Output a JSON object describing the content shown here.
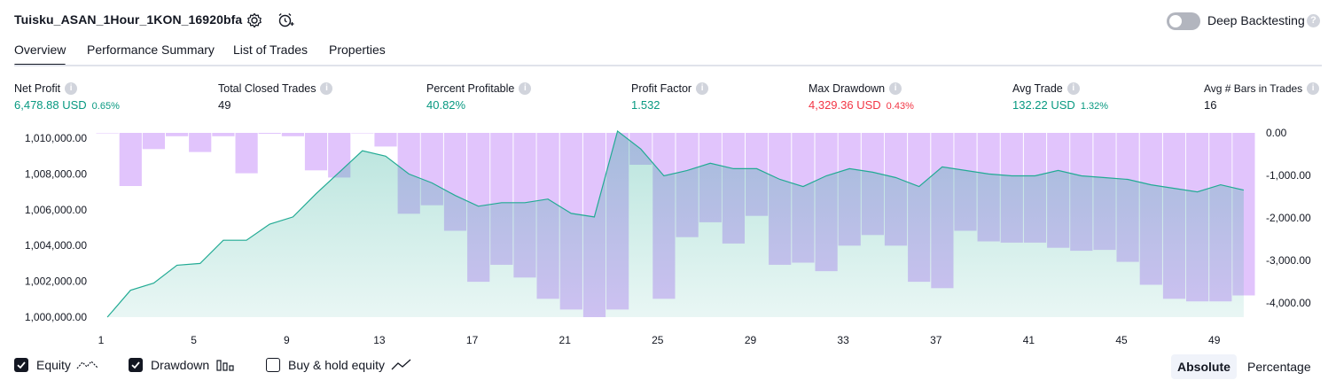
{
  "header": {
    "strategy_title": "Tuisku_ASAN_1Hour_1KON_16920bfa",
    "deep_backtesting_label": "Deep Backtesting",
    "deep_backtesting_enabled": false
  },
  "tabs": [
    {
      "label": "Overview",
      "active": true
    },
    {
      "label": "Performance Summary",
      "active": false
    },
    {
      "label": "List of Trades",
      "active": false
    },
    {
      "label": "Properties",
      "active": false
    }
  ],
  "metrics": [
    {
      "label": "Net Profit",
      "value": "6,478.88 USD",
      "pct": "0.65%",
      "color": "green"
    },
    {
      "label": "Total Closed Trades",
      "value": "49",
      "pct": "",
      "color": "black"
    },
    {
      "label": "Percent Profitable",
      "value": "40.82%",
      "pct": "",
      "color": "green"
    },
    {
      "label": "Profit Factor",
      "value": "1.532",
      "pct": "",
      "color": "green"
    },
    {
      "label": "Max Drawdown",
      "value": "4,329.36 USD",
      "pct": "0.43%",
      "color": "red"
    },
    {
      "label": "Avg Trade",
      "value": "132.22 USD",
      "pct": "1.32%",
      "color": "green"
    },
    {
      "label": "Avg # Bars in Trades",
      "value": "16",
      "pct": "",
      "color": "black"
    }
  ],
  "chart_data": {
    "type": "area",
    "x": [
      1,
      2,
      3,
      4,
      5,
      6,
      7,
      8,
      9,
      10,
      11,
      12,
      13,
      14,
      15,
      16,
      17,
      18,
      19,
      20,
      21,
      22,
      23,
      24,
      25,
      26,
      27,
      28,
      29,
      30,
      31,
      32,
      33,
      34,
      35,
      36,
      37,
      38,
      39,
      40,
      41,
      42,
      43,
      44,
      45,
      46,
      47,
      48,
      49,
      50
    ],
    "x_tick_labels": [
      "1",
      "5",
      "9",
      "13",
      "17",
      "21",
      "25",
      "29",
      "33",
      "37",
      "41",
      "45",
      "49"
    ],
    "equity_axis": {
      "ticks": [
        "1,000,000.00",
        "1,002,000.00",
        "1,004,000.00",
        "1,006,000.00",
        "1,008,000.00",
        "1,010,000.00"
      ],
      "ylim": [
        1000000,
        1010300
      ]
    },
    "drawdown_axis": {
      "ticks": [
        "0.00",
        "-1,000.00",
        "-2,000.00",
        "-3,000.00",
        "-4,000.00"
      ],
      "ylim": [
        -4330,
        0
      ]
    },
    "series": [
      {
        "name": "Equity",
        "values": [
          1000000,
          1001500,
          1001900,
          1002900,
          1003000,
          1004300,
          1004300,
          1005200,
          1005600,
          1006900,
          1008100,
          1009300,
          1009000,
          1008000,
          1007500,
          1006800,
          1006200,
          1006400,
          1006400,
          1006600,
          1005800,
          1005600,
          1010400,
          1009400,
          1007900,
          1008200,
          1008600,
          1008300,
          1008300,
          1007700,
          1007300,
          1007900,
          1008300,
          1008100,
          1007800,
          1007300,
          1008400,
          1008200,
          1008000,
          1007900,
          1007900,
          1008200,
          1007900,
          1007800,
          1007700,
          1007400,
          1007200,
          1007000,
          1007400,
          1007100
        ]
      },
      {
        "name": "Drawdown",
        "values": [
          0,
          -1250,
          -380,
          -80,
          -450,
          -80,
          -950,
          -20,
          -80,
          -880,
          -1050,
          0,
          -320,
          -1900,
          -1700,
          -2300,
          -3500,
          -3100,
          -3400,
          -3900,
          -4150,
          -4329,
          -4150,
          -750,
          -3900,
          -2450,
          -2100,
          -2600,
          -1950,
          -3100,
          -3050,
          -3250,
          -2650,
          -2400,
          -2650,
          -3500,
          -3650,
          -2300,
          -2550,
          -2580,
          -2580,
          -2700,
          -2770,
          -2750,
          -3030,
          -3570,
          -3900,
          -3960,
          -3960,
          -3820
        ]
      },
      {
        "name": "Buy & hold equity",
        "values": []
      }
    ]
  },
  "legend": [
    {
      "label": "Equity",
      "checked": true
    },
    {
      "label": "Drawdown",
      "checked": true
    },
    {
      "label": "Buy & hold equity",
      "checked": false
    }
  ],
  "scale_mode": {
    "options": [
      "Absolute",
      "Percentage"
    ],
    "selected": "Absolute"
  },
  "colors": {
    "accent_green": "#089981",
    "accent_red": "#f23645",
    "equity_line": "#22ab94",
    "drawdown_fill": "#e1c4fc",
    "text": "#131722"
  }
}
